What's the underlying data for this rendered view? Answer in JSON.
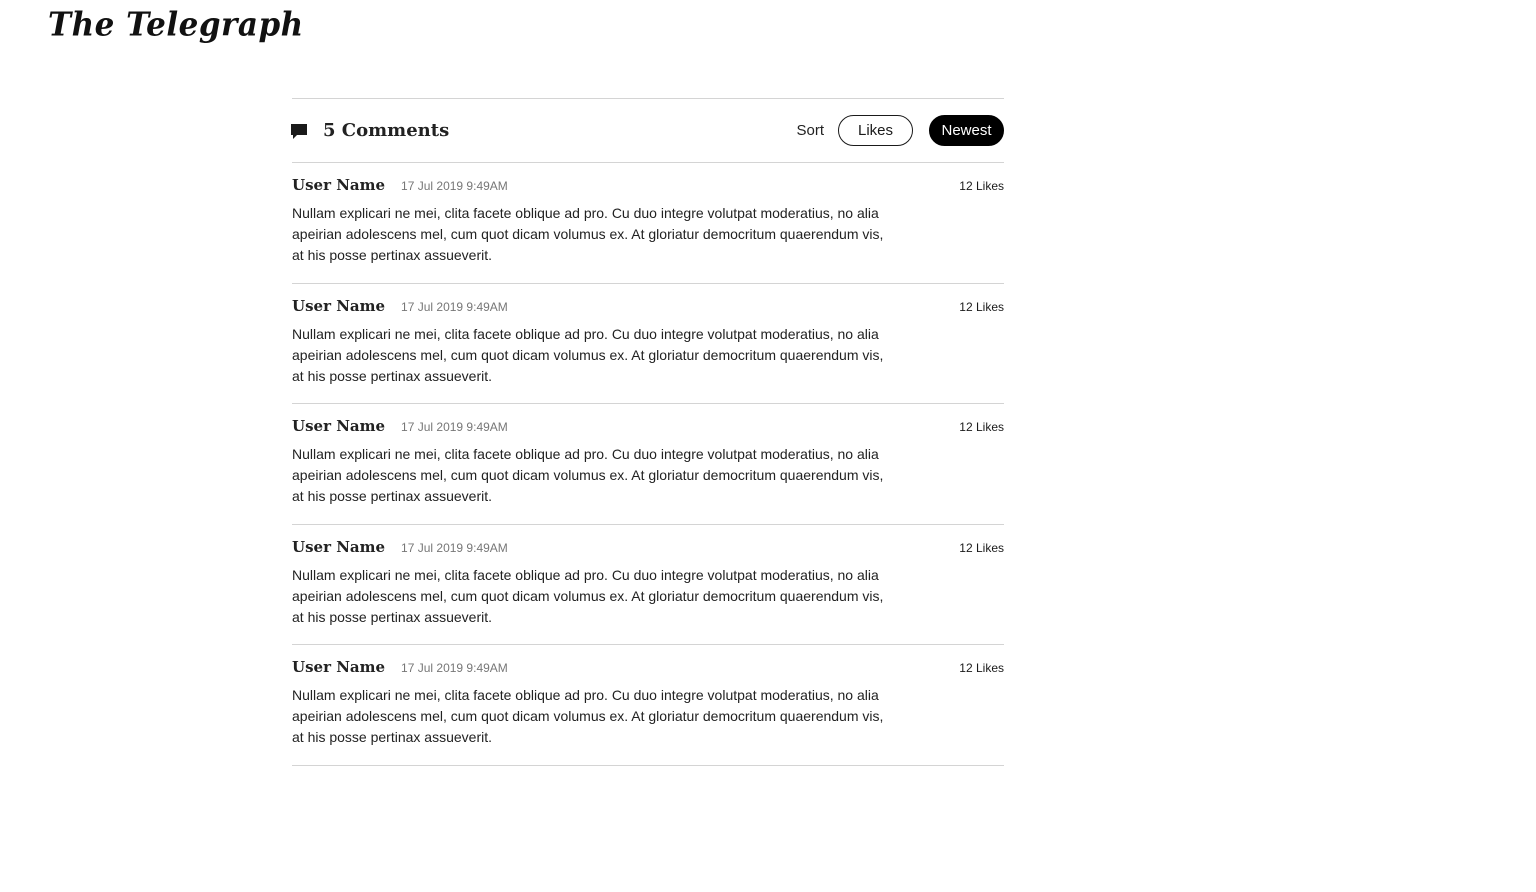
{
  "header": {
    "logo_text": "The Telegraph"
  },
  "comments_section": {
    "count_label": "5 Comments",
    "sort": {
      "label": "Sort",
      "options": [
        "Likes",
        "Newest"
      ],
      "selected": "Newest"
    },
    "items": [
      {
        "user_name": "User Name",
        "timestamp": "17 Jul 2019 9:49AM",
        "likes": "12 Likes",
        "body": "Nullam explicari ne mei, clita facete oblique ad pro. Cu duo integre volutpat moderatius, no alia apeirian adolescens mel, cum quot dicam volumus ex. At gloriatur democritum quaerendum vis, at his posse pertinax assueverit."
      },
      {
        "user_name": "User Name",
        "timestamp": "17 Jul 2019 9:49AM",
        "likes": "12 Likes",
        "body": "Nullam explicari ne mei, clita facete oblique ad pro. Cu duo integre volutpat moderatius, no alia apeirian adolescens mel, cum quot dicam volumus ex. At gloriatur democritum quaerendum vis, at his posse pertinax assueverit."
      },
      {
        "user_name": "User Name",
        "timestamp": "17 Jul 2019 9:49AM",
        "likes": "12 Likes",
        "body": "Nullam explicari ne mei, clita facete oblique ad pro. Cu duo integre volutpat moderatius, no alia apeirian adolescens mel, cum quot dicam volumus ex. At gloriatur democritum quaerendum vis, at his posse pertinax assueverit."
      },
      {
        "user_name": "User Name",
        "timestamp": "17 Jul 2019 9:49AM",
        "likes": "12 Likes",
        "body": "Nullam explicari ne mei, clita facete oblique ad pro. Cu duo integre volutpat moderatius, no alia apeirian adolescens mel, cum quot dicam volumus ex. At gloriatur democritum quaerendum vis, at his posse pertinax assueverit."
      },
      {
        "user_name": "User Name",
        "timestamp": "17 Jul 2019 9:49AM",
        "likes": "12 Likes",
        "body": "Nullam explicari ne mei, clita facete oblique ad pro. Cu duo integre volutpat moderatius, no alia apeirian adolescens mel, cum quot dicam volumus ex. At gloriatur democritum quaerendum vis, at his posse pertinax assueverit."
      }
    ]
  },
  "icons": {
    "comment": "speech-bubble-icon"
  },
  "colors": {
    "text": "#1a1a1a",
    "muted": "#777777",
    "divider": "#d4d4d4",
    "selected_button_bg": "#000000",
    "selected_button_text": "#ffffff"
  }
}
